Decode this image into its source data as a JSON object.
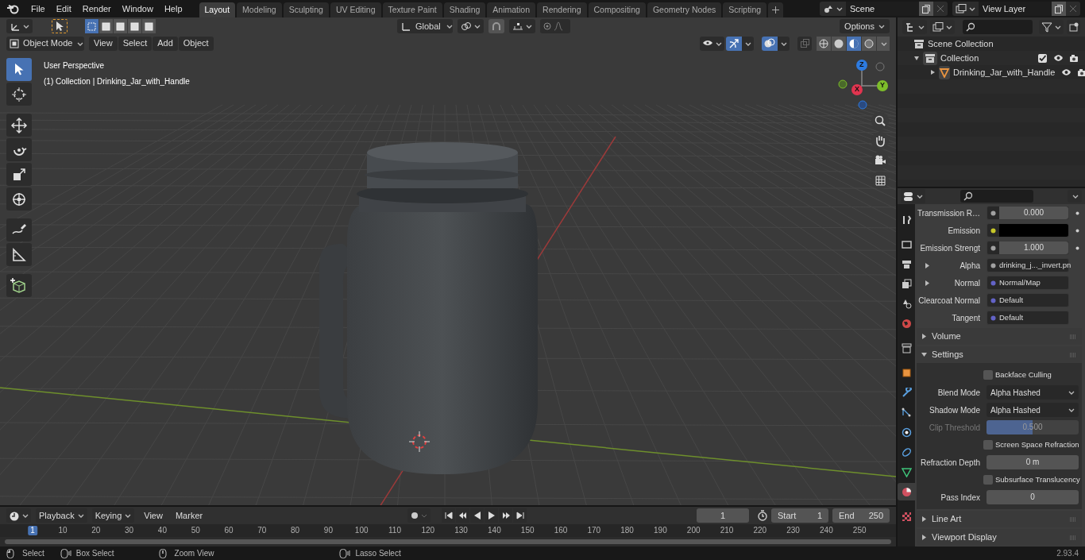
{
  "menu": [
    "File",
    "Edit",
    "Render",
    "Window",
    "Help"
  ],
  "workspaces": [
    {
      "label": "Layout",
      "selected": true
    },
    {
      "label": "Modeling",
      "selected": false
    },
    {
      "label": "Sculpting",
      "selected": false
    },
    {
      "label": "UV Editing",
      "selected": false
    },
    {
      "label": "Texture Paint",
      "selected": false
    },
    {
      "label": "Shading",
      "selected": false
    },
    {
      "label": "Animation",
      "selected": false
    },
    {
      "label": "Rendering",
      "selected": false
    },
    {
      "label": "Compositing",
      "selected": false
    },
    {
      "label": "Geometry Nodes",
      "selected": false
    },
    {
      "label": "Scripting",
      "selected": false
    }
  ],
  "scene": "Scene",
  "view_layer": "View Layer",
  "viewport": {
    "snap": false,
    "gizmos": true,
    "overlays": true,
    "x_ray": false,
    "mode": "Object Mode",
    "menus": [
      "View",
      "Select",
      "Add",
      "Object"
    ],
    "orientation": "Global",
    "options": "Options",
    "view_name": "User Perspective",
    "object_info": "(1) Collection | Drinking_Jar_with_Handle",
    "select_modes": [
      {
        "selected": true
      },
      {
        "selected": false
      },
      {
        "selected": false
      },
      {
        "selected": false
      },
      {
        "selected": false
      }
    ],
    "shading_modes": [
      {
        "kind": "wireframe",
        "selected": false
      },
      {
        "kind": "solid",
        "selected": false
      },
      {
        "kind": "material",
        "selected": true
      },
      {
        "kind": "rendered",
        "selected": false
      }
    ],
    "gizmo_axes": [
      {
        "label": "Z",
        "color": "#2d7be0"
      },
      {
        "label": "Y",
        "color": "#7dbd2a"
      },
      {
        "label": "X",
        "color": "#e0344f"
      }
    ],
    "tools": [
      {
        "kind": "select",
        "selected": true
      },
      {
        "kind": "cursor",
        "selected": false
      },
      {
        "kind": "move",
        "selected": false
      },
      {
        "kind": "rotate",
        "selected": false
      },
      {
        "kind": "scale",
        "selected": false
      },
      {
        "kind": "transform",
        "selected": false
      },
      {
        "kind": "annotate",
        "selected": false
      },
      {
        "kind": "measure",
        "selected": false
      },
      {
        "kind": "add-cube",
        "selected": false
      }
    ]
  },
  "outliner": {
    "items": [
      {
        "label": "Scene Collection",
        "kind": "scene",
        "children": [
          {
            "label": "Collection",
            "kind": "collection",
            "expanded": true,
            "checked": true,
            "children": [
              {
                "label": "Drinking_Jar_with_Handle",
                "kind": "mesh",
                "expanded": false
              }
            ]
          }
        ]
      }
    ]
  },
  "properties": {
    "tabs": [
      {
        "kind": "tool",
        "selected": false
      },
      {
        "kind": "render",
        "selected": false
      },
      {
        "kind": "output",
        "selected": false
      },
      {
        "kind": "view-layer",
        "selected": false
      },
      {
        "kind": "scene",
        "selected": false
      },
      {
        "kind": "world",
        "selected": false
      },
      {
        "kind": "collection",
        "selected": false
      },
      {
        "kind": "object",
        "selected": false
      },
      {
        "kind": "modifier",
        "selected": false
      },
      {
        "kind": "particles",
        "selected": false
      },
      {
        "kind": "physics",
        "selected": false
      },
      {
        "kind": "constraints",
        "selected": false
      },
      {
        "kind": "data",
        "selected": false
      },
      {
        "kind": "material",
        "selected": true
      },
      {
        "kind": "texture",
        "selected": false
      }
    ],
    "sockets": [
      {
        "label": "Transmission R…",
        "kind": "number",
        "value": "0.000",
        "color": "#a1a1a1"
      },
      {
        "label": "Emission",
        "kind": "color",
        "swatch": {
          "color": "#000000"
        },
        "color": "#c7c729"
      },
      {
        "label": "Emission Strengt",
        "kind": "number",
        "value": "1.000",
        "color": "#a1a1a1"
      },
      {
        "label": "Alpha",
        "kind": "link",
        "value": "drinking_j..._invert.pn",
        "expanded": false,
        "color": "#a1a1a1"
      },
      {
        "label": "Normal",
        "kind": "link",
        "value": "Normal/Map",
        "expanded": false,
        "color": "#6363c7"
      },
      {
        "label": "Clearcoat Normal",
        "kind": "link",
        "value": "Default",
        "color": "#6363c7"
      },
      {
        "label": "Tangent",
        "kind": "link",
        "value": "Default",
        "color": "#6363c7"
      }
    ],
    "panels": [
      {
        "title": "Volume",
        "expanded": false
      },
      {
        "title": "Settings",
        "expanded": true,
        "rows": [
          {
            "kind": "checkbox",
            "label": "Backface Culling",
            "checked": false
          },
          {
            "kind": "dropdown",
            "label": "Blend Mode",
            "value": "Alpha Hashed"
          },
          {
            "kind": "dropdown",
            "label": "Shadow Mode",
            "value": "Alpha Hashed"
          },
          {
            "kind": "slider",
            "label": "Clip Threshold",
            "value": "0.500",
            "level": 0.5,
            "disabled": true
          },
          {
            "kind": "checkbox",
            "label": "Screen Space Refraction",
            "checked": false
          },
          {
            "kind": "number",
            "label": "Refraction Depth",
            "value": "0 m"
          },
          {
            "kind": "checkbox",
            "label": "Subsurface Translucency",
            "checked": false
          },
          {
            "kind": "number",
            "label": "Pass Index",
            "value": "0"
          }
        ]
      },
      {
        "title": "Line Art",
        "expanded": false
      },
      {
        "title": "Viewport Display",
        "expanded": false
      }
    ]
  },
  "timeline": {
    "auto_keying": false,
    "menus": [
      "Playback",
      "Keying",
      "View",
      "Marker"
    ],
    "current_frame": "1",
    "start_label": "Start",
    "start": "1",
    "end_label": "End",
    "end": "250",
    "ruler": [
      "1",
      "10",
      "20",
      "30",
      "40",
      "50",
      "60",
      "70",
      "80",
      "90",
      "100",
      "110",
      "120",
      "130",
      "140",
      "150",
      "160",
      "170",
      "180",
      "190",
      "200",
      "210",
      "220",
      "230",
      "240",
      "250"
    ]
  },
  "status_bar": {
    "hints": [
      {
        "kind": "left",
        "label": "Select"
      },
      {
        "kind": "drag",
        "label": "Box Select"
      },
      {
        "kind": "middle",
        "label": "Zoom View"
      },
      {
        "kind": "drag",
        "label": "Lasso Select"
      }
    ],
    "version": "2.93.4"
  }
}
